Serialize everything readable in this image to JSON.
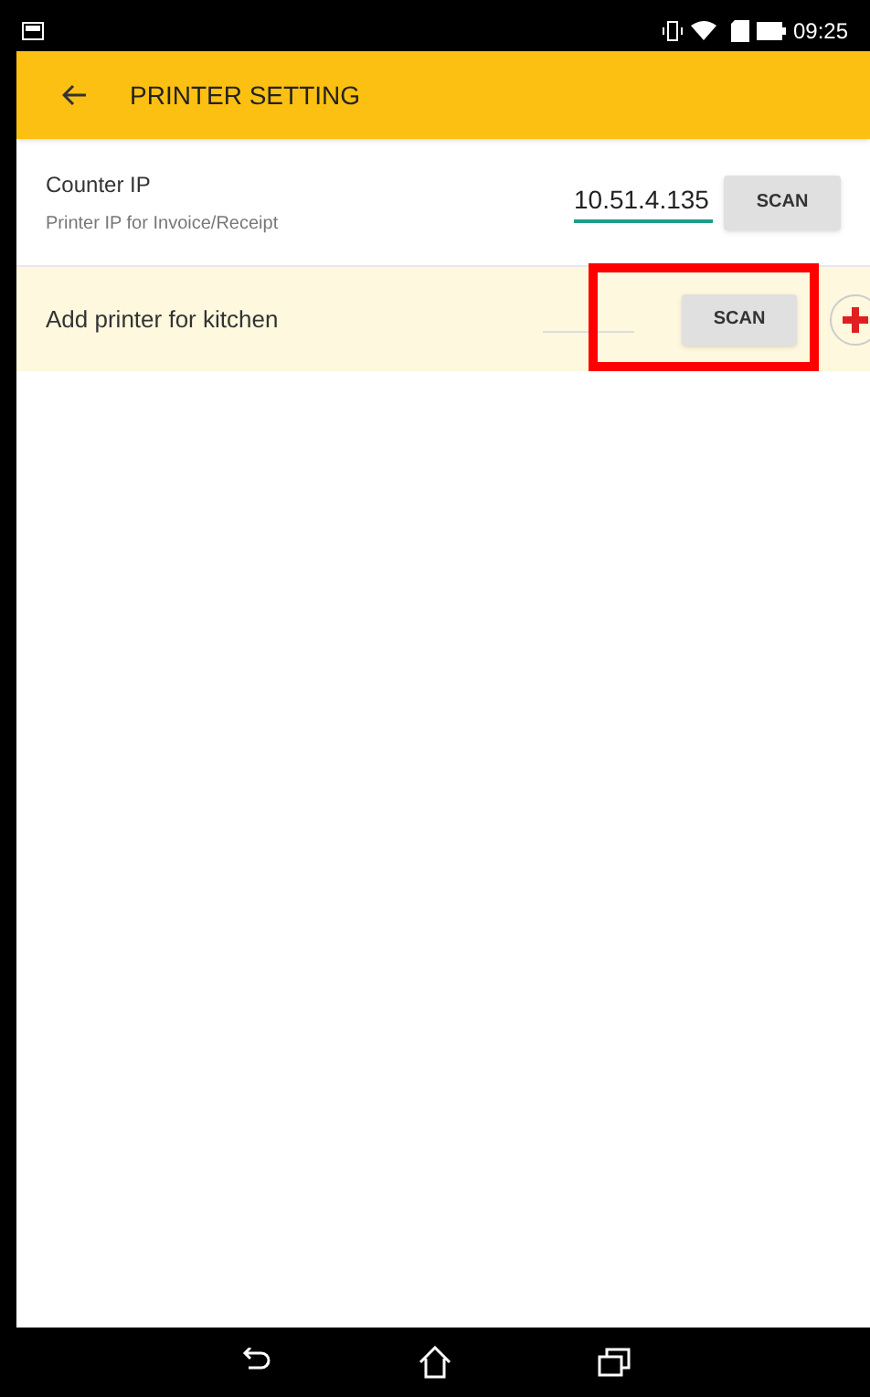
{
  "status_bar": {
    "time": "09:25"
  },
  "app_bar": {
    "title": "PRINTER SETTING"
  },
  "counter": {
    "title": "Counter IP",
    "subtitle": "Printer IP for Invoice/Receipt",
    "value": "10.51.4.135",
    "button": "SCAN"
  },
  "kitchen": {
    "label": "Add printer for kitchen",
    "button": "SCAN",
    "highlighted": true
  }
}
